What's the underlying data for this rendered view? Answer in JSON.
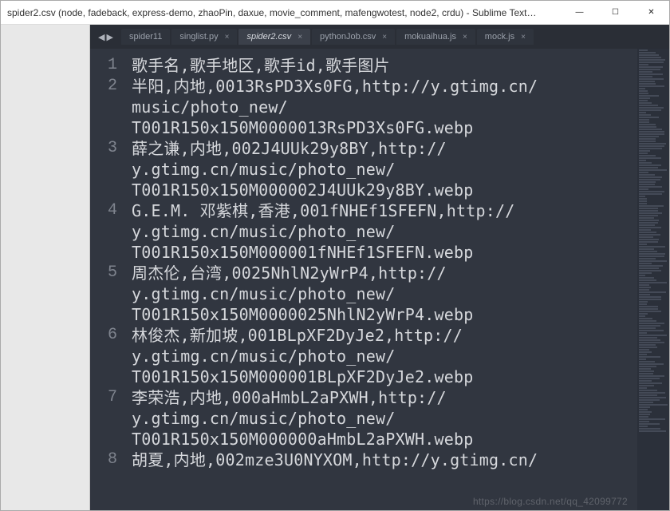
{
  "window": {
    "title": "spider2.csv (node, fadeback, express-demo, zhaoPin, daxue, movie_comment, mafengwotest, node2, crdu) - Sublime Text…"
  },
  "nav": {
    "prev_glyph": "◀",
    "next_glyph": "▶"
  },
  "tabs": [
    {
      "label": "spider11",
      "closeable": false,
      "active": false
    },
    {
      "label": "singlist.py",
      "closeable": true,
      "active": false
    },
    {
      "label": "spider2.csv",
      "closeable": true,
      "active": true
    },
    {
      "label": "pythonJob.csv",
      "closeable": true,
      "active": false
    },
    {
      "label": "mokuaihua.js",
      "closeable": true,
      "active": false
    },
    {
      "label": "mock.js",
      "closeable": true,
      "active": false
    }
  ],
  "close_x": "×",
  "wincontrols": {
    "min": "—",
    "max": "☐",
    "close": "✕"
  },
  "lines": [
    {
      "no": "1",
      "wraps": [
        "歌手名,歌手地区,歌手id,歌手图片"
      ]
    },
    {
      "no": "2",
      "wraps": [
        "半阳,内地,0013RsPD3Xs0FG,http://y.gtimg.cn/",
        "music/photo_new/",
        "T001R150x150M0000013RsPD3Xs0FG.webp"
      ]
    },
    {
      "no": "3",
      "wraps": [
        "薛之谦,内地,002J4UUk29y8BY,http://",
        "y.gtimg.cn/music/photo_new/",
        "T001R150x150M000002J4UUk29y8BY.webp"
      ]
    },
    {
      "no": "4",
      "wraps": [
        "G.E.M. 邓紫棋,香港,001fNHEf1SFEFN,http://",
        "y.gtimg.cn/music/photo_new/",
        "T001R150x150M000001fNHEf1SFEFN.webp"
      ]
    },
    {
      "no": "5",
      "wraps": [
        "周杰伦,台湾,0025NhlN2yWrP4,http://",
        "y.gtimg.cn/music/photo_new/",
        "T001R150x150M0000025NhlN2yWrP4.webp"
      ]
    },
    {
      "no": "6",
      "wraps": [
        "林俊杰,新加坡,001BLpXF2DyJe2,http://",
        "y.gtimg.cn/music/photo_new/",
        "T001R150x150M000001BLpXF2DyJe2.webp"
      ]
    },
    {
      "no": "7",
      "wraps": [
        "李荣浩,内地,000aHmbL2aPXWH,http://",
        "y.gtimg.cn/music/photo_new/",
        "T001R150x150M000000aHmbL2aPXWH.webp"
      ]
    },
    {
      "no": "8",
      "wraps": [
        "胡夏,内地,002mze3U0NYXOM,http://y.gtimg.cn/"
      ]
    }
  ],
  "watermark": "https://blog.csdn.net/qq_42099772"
}
